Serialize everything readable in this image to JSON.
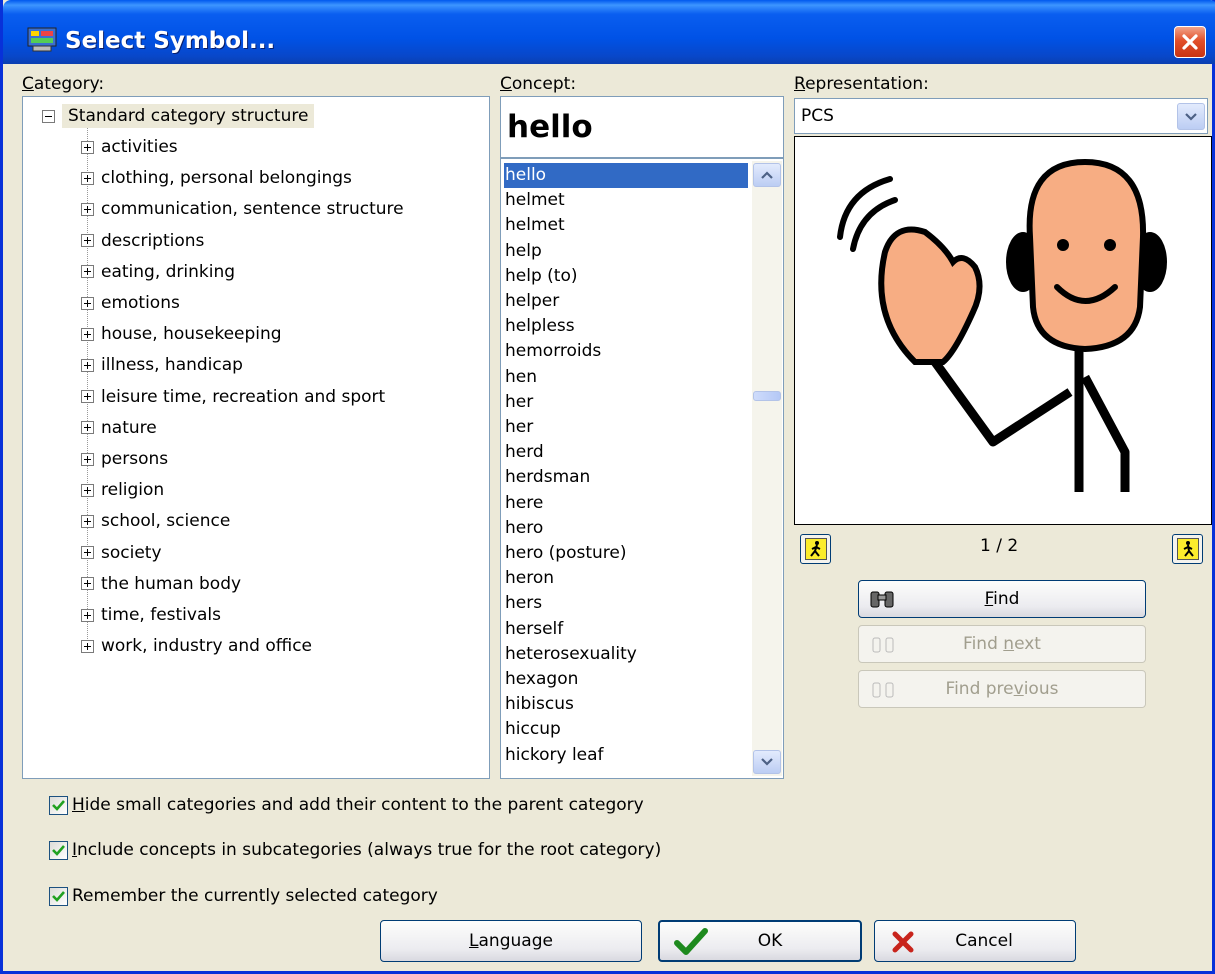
{
  "window": {
    "title": "Select Symbol..."
  },
  "category": {
    "label_first": "C",
    "label_rest": "ategory:",
    "root": "Standard category structure",
    "items": [
      "activities",
      "clothing, personal belongings",
      "communication, sentence structure",
      "descriptions",
      "eating, drinking",
      "emotions",
      "house, housekeeping",
      "illness, handicap",
      "leisure time, recreation and sport",
      "nature",
      "persons",
      "religion",
      "school, science",
      "society",
      "the human body",
      "time, festivals",
      "work, industry and office"
    ]
  },
  "concept": {
    "label_first": "C",
    "label_rest": "oncept:",
    "value": "hello",
    "list": [
      "hello",
      "helmet",
      "helmet",
      "help",
      "help (to)",
      "helper",
      "helpless",
      "hemorroids",
      "hen",
      "her",
      "her",
      "herd",
      "herdsman",
      "here",
      "hero",
      "hero (posture)",
      "heron",
      "hers",
      "herself",
      "heterosexuality",
      "hexagon",
      "hibiscus",
      "hiccup",
      "hickory leaf"
    ],
    "selected_index": 0
  },
  "representation": {
    "label_first": "R",
    "label_rest": "epresentation:",
    "selected": "PCS",
    "page": "1 / 2"
  },
  "find": {
    "find_first": "F",
    "find_rest": "ind",
    "next_pre": "Find ",
    "next_u": "n",
    "next_post": "ext",
    "prev_pre": "Find pre",
    "prev_u": "v",
    "prev_post": "ious"
  },
  "options": [
    {
      "u": "H",
      "rest": "ide small categories and add their content to the parent category",
      "checked": true
    },
    {
      "u": "I",
      "rest": "nclude concepts in subcategories (always true for the root category)",
      "checked": true
    },
    {
      "u": "",
      "rest": "Remember the currently selected category",
      "checked": true
    }
  ],
  "buttons": {
    "language_u": "L",
    "language_rest": "anguage",
    "ok": "OK",
    "cancel": "Cancel"
  }
}
